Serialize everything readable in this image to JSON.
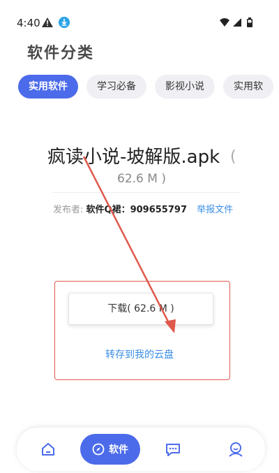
{
  "status_bar": {
    "time": "4:40",
    "icons": [
      "warning-icon",
      "download-icon",
      "wifi-icon",
      "signal-icon",
      "battery-icon"
    ]
  },
  "page": {
    "title": "软件分类"
  },
  "tabs": [
    {
      "label": "实用软件",
      "active": true
    },
    {
      "label": "学习必备",
      "active": false
    },
    {
      "label": "影视小说",
      "active": false
    },
    {
      "label": "实用软",
      "active": false
    }
  ],
  "file": {
    "name": "疯读小说-坡解版.apk",
    "paren_open": "(",
    "size": "62.6 M )",
    "publisher_label": "发布者:",
    "publisher_name": "软件Q裙：909655797",
    "report_label": "举报文件"
  },
  "actions": {
    "download_label": "下载( 62.6 M )",
    "save_label": "转存到我的云盘"
  },
  "bottom_nav": {
    "items": [
      {
        "icon": "home-icon"
      },
      {
        "icon": "compass-icon",
        "label": "软件",
        "active": true
      },
      {
        "icon": "chat-icon"
      },
      {
        "icon": "profile-icon"
      }
    ]
  },
  "colors": {
    "accent": "#4b6bea",
    "link": "#3b8ee8",
    "annotation_red": "#e0584b"
  }
}
